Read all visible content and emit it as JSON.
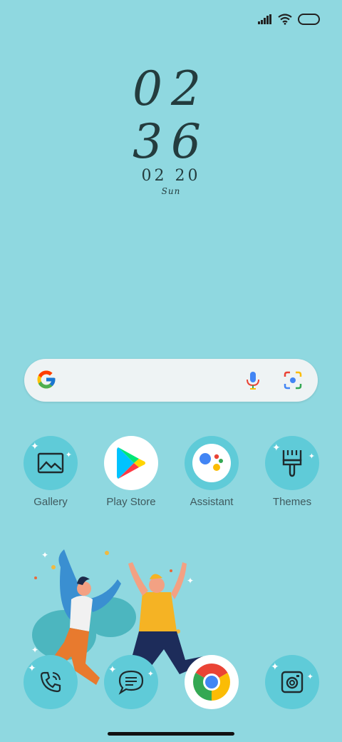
{
  "status": {
    "signal": "signal-icon",
    "wifi": "wifi-icon",
    "battery": "battery-icon"
  },
  "clock": {
    "hour": "02",
    "minute": "36",
    "date": "02 20",
    "day": "Sun"
  },
  "search": {
    "logo": "google-logo-icon",
    "mic": "mic-icon",
    "lens": "lens-icon"
  },
  "apps": [
    {
      "label": "Gallery",
      "icon": "gallery-icon"
    },
    {
      "label": "Play Store",
      "icon": "play-store-icon"
    },
    {
      "label": "Assistant",
      "icon": "assistant-icon"
    },
    {
      "label": "Themes",
      "icon": "themes-brush-icon"
    }
  ],
  "dock": [
    {
      "icon": "phone-icon"
    },
    {
      "icon": "messages-icon"
    },
    {
      "icon": "chrome-icon"
    },
    {
      "icon": "camera-icon"
    }
  ],
  "colors": {
    "background": "#8fd8e0",
    "icon_bg": "#5fcbd8",
    "text": "#3f5a5e"
  }
}
